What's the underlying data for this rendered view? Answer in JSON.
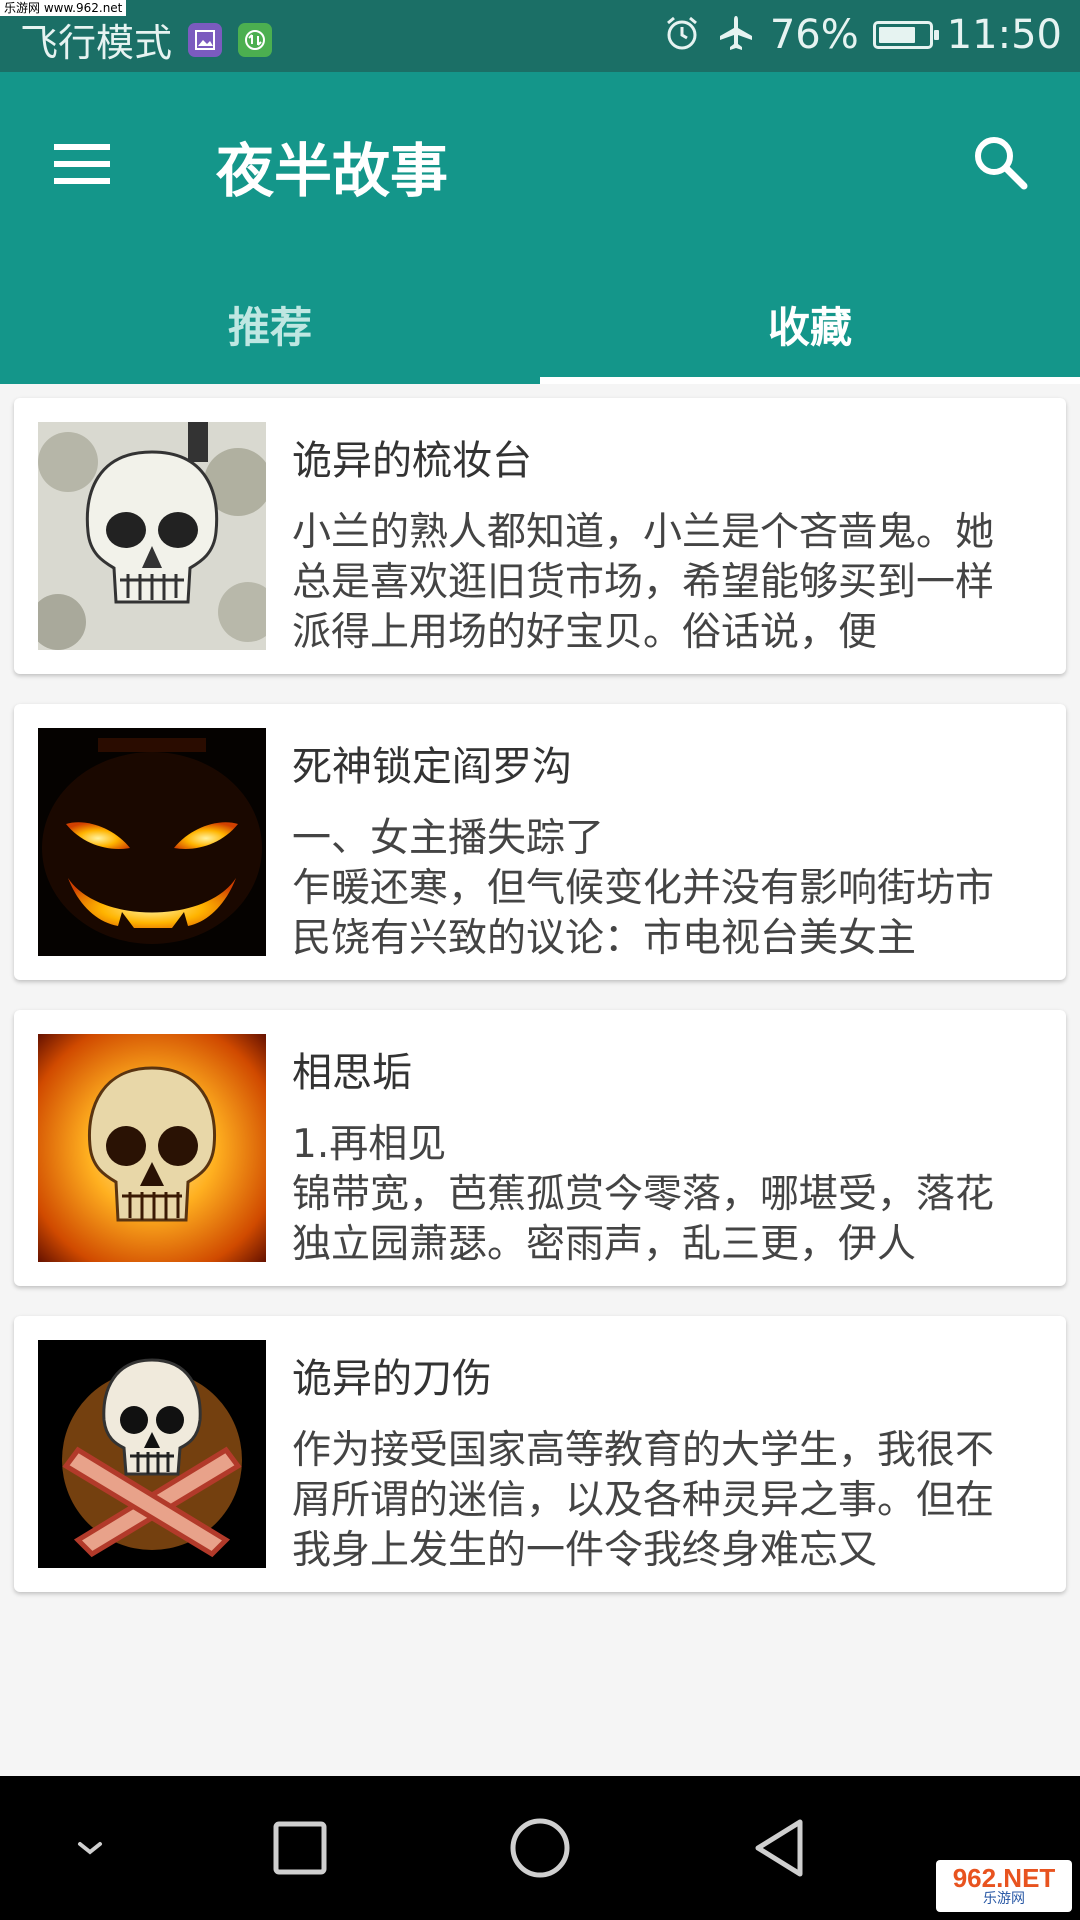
{
  "status_bar": {
    "watermark": "乐游网 www.962.net",
    "mode_text": "飞行模式",
    "battery_text": "76%",
    "battery_level": 0.76,
    "time": "11:50",
    "icons": [
      "gallery-notification-icon",
      "data-notification-icon",
      "alarm-icon",
      "airplane-icon",
      "battery-icon"
    ]
  },
  "app_bar": {
    "title": "夜半故事",
    "menu_icon": "menu-icon",
    "search_icon": "search-icon"
  },
  "tabs": [
    {
      "label": "推荐",
      "active": false
    },
    {
      "label": "收藏",
      "active": true
    }
  ],
  "stories": [
    {
      "title": "诡异的梳妆台",
      "excerpt": "小兰的熟人都知道，小兰是个吝啬鬼。她总是喜欢逛旧货市场，希望能够买到一样派得上用场的好宝贝。俗话说，便",
      "thumbnail": "skull-sketch-image"
    },
    {
      "title": "死神锁定阎罗沟",
      "excerpt": "一、女主播失踪了\n乍暖还寒，但气候变化并没有影响街坊市民饶有兴致的议论：市电视台美女主",
      "thumbnail": "jack-o-lantern-image"
    },
    {
      "title": "相思垢",
      "excerpt": "1.再相见\n锦带宽，芭蕉孤赏今零落，哪堪受，落花独立园萧瑟。密雨声，乱三更，伊人",
      "thumbnail": "flaming-skull-image"
    },
    {
      "title": "诡异的刀伤",
      "excerpt": "作为接受国家高等教育的大学生，我很不屑所谓的迷信，以及各种灵异之事。但在我身上发生的一件令我终身难忘又",
      "thumbnail": "skull-crossbones-image"
    }
  ],
  "nav_bar": {
    "buttons": [
      "collapse-icon",
      "recents-icon",
      "home-icon",
      "back-icon"
    ],
    "watermark_main": "962.NET",
    "watermark_sub": "乐游网"
  },
  "colors": {
    "status_bar": "#1b6f66",
    "app_bar": "#14968a",
    "background": "#f5f5f5",
    "nav_bar": "#000000"
  }
}
